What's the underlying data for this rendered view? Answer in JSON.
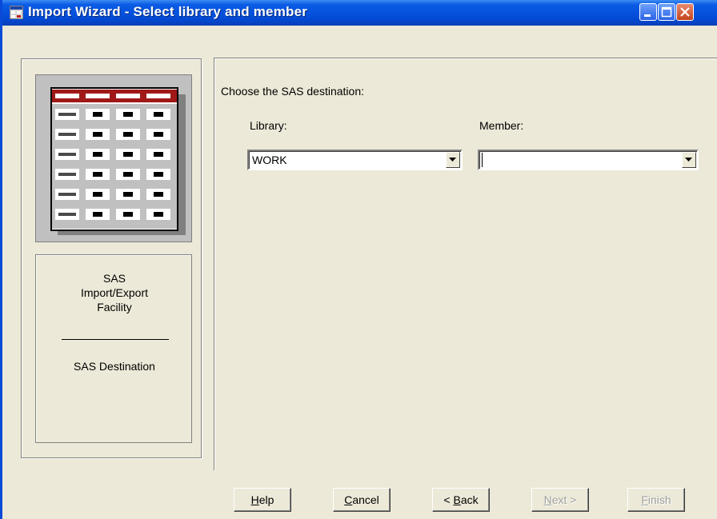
{
  "window": {
    "title": "Import Wizard - Select library and member",
    "controls": [
      "minimize",
      "maximize",
      "close"
    ]
  },
  "sidebar": {
    "icon": "sas-table-icon",
    "facility_lines": [
      "SAS",
      "Import/Export",
      "Facility"
    ],
    "step_label": "SAS Destination"
  },
  "main": {
    "prompt": "Choose the SAS destination:",
    "library": {
      "label": "Library:",
      "value": "WORK"
    },
    "member": {
      "label": "Member:",
      "value": ""
    }
  },
  "buttons": {
    "help": {
      "label": "Help",
      "mnemonic": "H",
      "rest": "elp",
      "enabled": true
    },
    "cancel": {
      "label": "Cancel",
      "mnemonic": "C",
      "rest": "ancel",
      "enabled": true
    },
    "back": {
      "label": "< Back",
      "prefix": "< ",
      "mnemonic": "B",
      "rest": "ack",
      "enabled": true
    },
    "next": {
      "label": "Next >",
      "mnemonic": "N",
      "rest": "ext >",
      "enabled": false
    },
    "finish": {
      "label": "Finish",
      "mnemonic": "F",
      "rest": "inish",
      "enabled": false
    }
  },
  "colors": {
    "titlebar": "#0552de",
    "dialog_bg": "#ece9d8",
    "table_header": "#a01818"
  }
}
